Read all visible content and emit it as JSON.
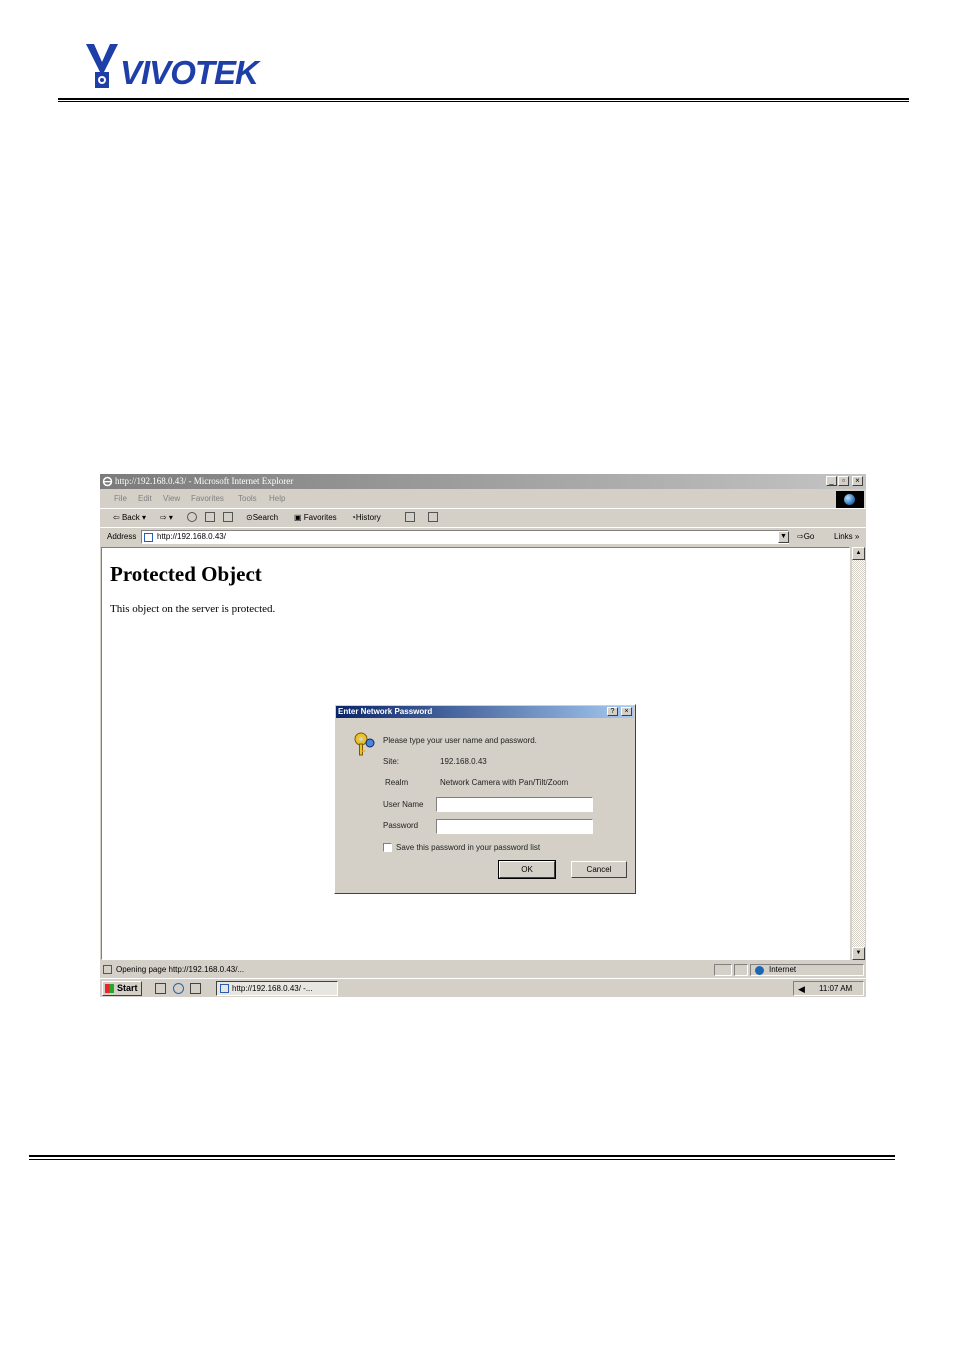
{
  "logo": {
    "text": "VIVOTEK",
    "color": "#1f3fa8"
  },
  "browser": {
    "title": "http://192.168.0.43/ - Microsoft Internet Explorer",
    "menu": [
      "File",
      "Edit",
      "View",
      "Favorites",
      "Tools",
      "Help"
    ],
    "toolbar": {
      "back": "Back",
      "search": "Search",
      "favorites": "Favorites",
      "history": "History"
    },
    "address": {
      "label": "Address",
      "value": "http://192.168.0.43/",
      "go": "Go",
      "links": "Links"
    },
    "page": {
      "heading": "Protected Object",
      "text": "This object on the server is protected."
    },
    "status": {
      "text": "Opening page http://192.168.0.43/...",
      "zone": "Internet"
    },
    "taskbar": {
      "start": "Start",
      "task": "http://192.168.0.43/ -...",
      "clock": "11:07 AM"
    }
  },
  "dialog": {
    "title": "Enter Network Password",
    "prompt": "Please type your user name and password.",
    "site_label": "Site:",
    "site_value": "192.168.0.43",
    "realm_label": "Realm",
    "realm_value": "Network Camera with Pan/Tilt/Zoom",
    "username_label": "User Name",
    "username_value": "",
    "password_label": "Password",
    "password_value": "",
    "save_label": "Save this password in your password list",
    "save_checked": false,
    "ok": "OK",
    "cancel": "Cancel"
  }
}
